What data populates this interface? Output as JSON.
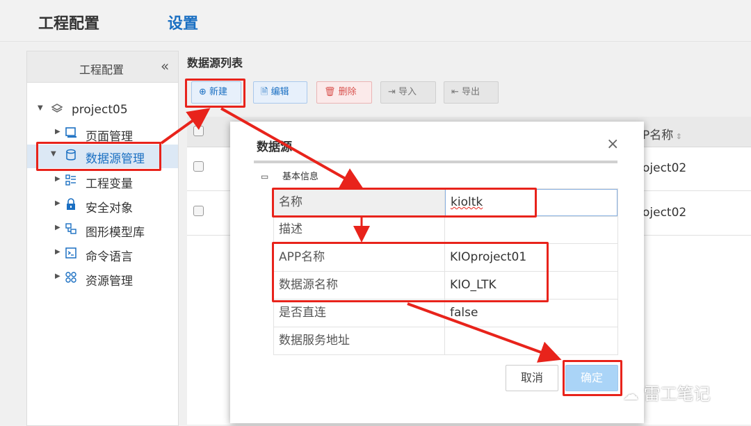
{
  "header": {
    "title": "工程配置",
    "settings_tab": "设置"
  },
  "sidebar": {
    "title": "工程配置",
    "collapse_icon": "«",
    "root": "project05",
    "items": [
      {
        "label": "页面管理",
        "icon": "page-icon"
      },
      {
        "label": "数据源管理",
        "icon": "database-icon",
        "selected": true
      },
      {
        "label": "工程变量",
        "icon": "variable-list-icon"
      },
      {
        "label": "安全对象",
        "icon": "lock-icon"
      },
      {
        "label": "图形模型库",
        "icon": "model-library-icon"
      },
      {
        "label": "命令语言",
        "icon": "terminal-icon"
      },
      {
        "label": "资源管理",
        "icon": "resource-icon"
      }
    ]
  },
  "main": {
    "list_title": "数据源列表",
    "toolbar": {
      "new": "新建",
      "edit": "编辑",
      "delete": "删除",
      "import": "导入",
      "export": "导出"
    },
    "table": {
      "app_header": "P名称",
      "rows": [
        {
          "app": "oject02"
        },
        {
          "app": "oject02"
        }
      ]
    }
  },
  "dialog": {
    "title": "数据源",
    "close": "×",
    "section": "基本信息",
    "section_toggle": "▭",
    "properties": [
      {
        "key": "名称",
        "value": "kioltk"
      },
      {
        "key": "描述",
        "value": ""
      },
      {
        "key": "APP名称",
        "value": "KIOproject01"
      },
      {
        "key": "数据源名称",
        "value": "KIO_LTK"
      },
      {
        "key": "是否直连",
        "value": "false"
      },
      {
        "key": "数据服务地址",
        "value": ""
      }
    ],
    "cancel": "取消",
    "ok": "确定"
  },
  "watermark": "雷工笔记",
  "colors": {
    "accent": "#1a6fc2",
    "highlight": "#e8231b",
    "ok_button": "#aad4f7"
  }
}
